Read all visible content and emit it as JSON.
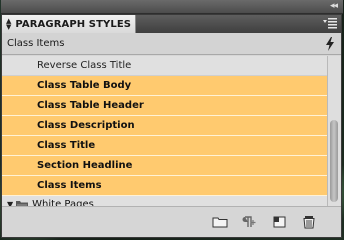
{
  "panel": {
    "tab_label": "PARAGRAPH STYLES",
    "current_style": "Class Items"
  },
  "styles": {
    "items": [
      {
        "label": "Reverse Class Title",
        "selected": false
      },
      {
        "label": "Class Table Body",
        "selected": true
      },
      {
        "label": "Class Table Header",
        "selected": true
      },
      {
        "label": "Class Description",
        "selected": true
      },
      {
        "label": "Class Title",
        "selected": true
      },
      {
        "label": "Section Headline",
        "selected": true
      },
      {
        "label": "Class Items",
        "selected": true
      }
    ],
    "groups": [
      {
        "label": "White Pages",
        "expanded": false
      }
    ]
  },
  "icons": {
    "collapse": "double-chevron-icon",
    "panel_menu": "panel-menu-icon",
    "quick_apply": "lightning-icon",
    "group_toggle": "triangle-icon",
    "group_folder": "folder-icon",
    "footer": [
      "new-group-icon",
      "clear-overrides-icon",
      "new-style-icon",
      "delete-icon"
    ]
  },
  "colors": {
    "selection": "#ffca6f",
    "panel_bg": "#d6d6d6",
    "tab_bar": "#4a4a4a"
  }
}
